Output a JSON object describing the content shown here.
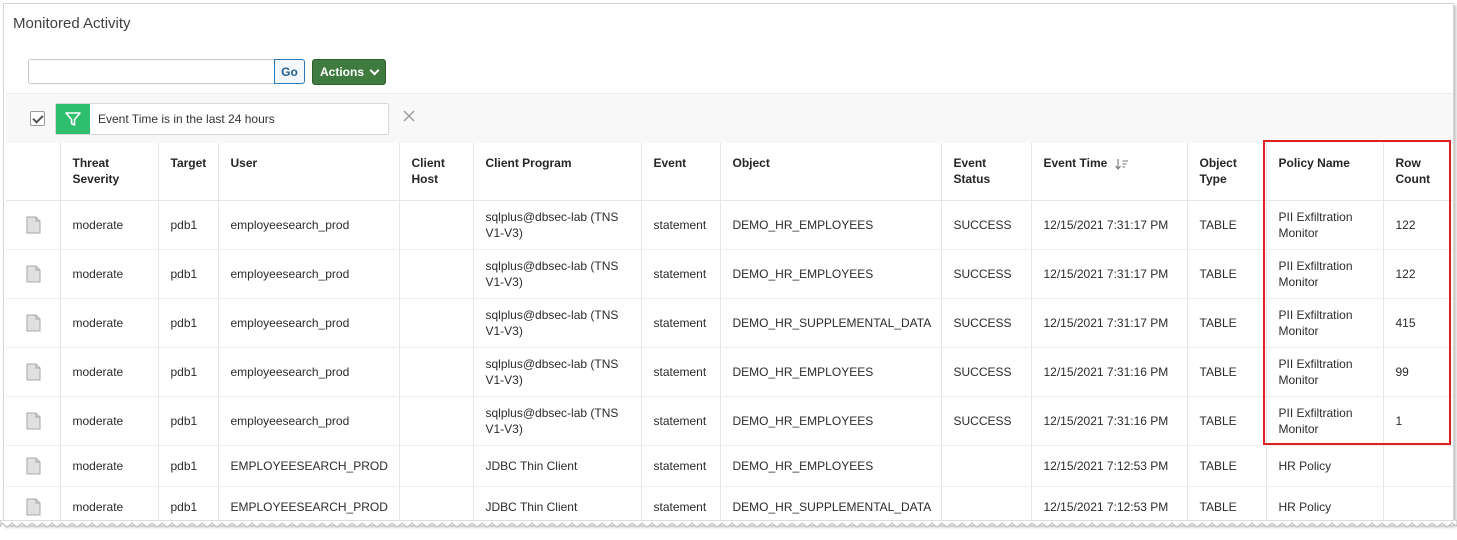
{
  "page": {
    "title": "Monitored Activity"
  },
  "toolbar": {
    "search_value": "",
    "go_label": "Go",
    "actions_label": "Actions"
  },
  "filter": {
    "text": "Event Time is in the last 24 hours",
    "enabled": true
  },
  "table": {
    "columns": [
      {
        "key": "icon",
        "label": ""
      },
      {
        "key": "threat_severity",
        "label": "Threat Severity"
      },
      {
        "key": "target",
        "label": "Target"
      },
      {
        "key": "user",
        "label": "User"
      },
      {
        "key": "client_host",
        "label": "Client Host"
      },
      {
        "key": "client_program",
        "label": "Client Program"
      },
      {
        "key": "event",
        "label": "Event"
      },
      {
        "key": "object",
        "label": "Object"
      },
      {
        "key": "event_status",
        "label": "Event Status"
      },
      {
        "key": "event_time",
        "label": "Event Time",
        "sorted": "descending"
      },
      {
        "key": "object_type",
        "label": "Object Type"
      },
      {
        "key": "policy_name",
        "label": "Policy Name"
      },
      {
        "key": "row_count",
        "label": "Row Count"
      }
    ],
    "rows": [
      {
        "threat_severity": "moderate",
        "target": "pdb1",
        "user": "employeesearch_prod",
        "client_host": "",
        "client_program": "sqlplus@dbsec-lab (TNS V1-V3)",
        "event": "statement",
        "object": "DEMO_HR_EMPLOYEES",
        "event_status": "SUCCESS",
        "event_time": "12/15/2021 7:31:17 PM",
        "object_type": "TABLE",
        "policy_name": "PII Exfiltration Monitor",
        "row_count": "122"
      },
      {
        "threat_severity": "moderate",
        "target": "pdb1",
        "user": "employeesearch_prod",
        "client_host": "",
        "client_program": "sqlplus@dbsec-lab (TNS V1-V3)",
        "event": "statement",
        "object": "DEMO_HR_EMPLOYEES",
        "event_status": "SUCCESS",
        "event_time": "12/15/2021 7:31:17 PM",
        "object_type": "TABLE",
        "policy_name": "PII Exfiltration Monitor",
        "row_count": "122"
      },
      {
        "threat_severity": "moderate",
        "target": "pdb1",
        "user": "employeesearch_prod",
        "client_host": "",
        "client_program": "sqlplus@dbsec-lab (TNS V1-V3)",
        "event": "statement",
        "object": "DEMO_HR_SUPPLEMENTAL_DATA",
        "event_status": "SUCCESS",
        "event_time": "12/15/2021 7:31:17 PM",
        "object_type": "TABLE",
        "policy_name": "PII Exfiltration Monitor",
        "row_count": "415"
      },
      {
        "threat_severity": "moderate",
        "target": "pdb1",
        "user": "employeesearch_prod",
        "client_host": "",
        "client_program": "sqlplus@dbsec-lab (TNS V1-V3)",
        "event": "statement",
        "object": "DEMO_HR_EMPLOYEES",
        "event_status": "SUCCESS",
        "event_time": "12/15/2021 7:31:16 PM",
        "object_type": "TABLE",
        "policy_name": "PII Exfiltration Monitor",
        "row_count": "99"
      },
      {
        "threat_severity": "moderate",
        "target": "pdb1",
        "user": "employeesearch_prod",
        "client_host": "",
        "client_program": "sqlplus@dbsec-lab (TNS V1-V3)",
        "event": "statement",
        "object": "DEMO_HR_EMPLOYEES",
        "event_status": "SUCCESS",
        "event_time": "12/15/2021 7:31:16 PM",
        "object_type": "TABLE",
        "policy_name": "PII Exfiltration Monitor",
        "row_count": "1"
      },
      {
        "threat_severity": "moderate",
        "target": "pdb1",
        "user": "EMPLOYEESEARCH_PROD",
        "client_host": "",
        "client_program": "JDBC Thin Client",
        "event": "statement",
        "object": "DEMO_HR_EMPLOYEES",
        "event_status": "",
        "event_time": "12/15/2021 7:12:53 PM",
        "object_type": "TABLE",
        "policy_name": "HR Policy",
        "row_count": ""
      },
      {
        "threat_severity": "moderate",
        "target": "pdb1",
        "user": "EMPLOYEESEARCH_PROD",
        "client_host": "",
        "client_program": "JDBC Thin Client",
        "event": "statement",
        "object": "DEMO_HR_SUPPLEMENTAL_DATA",
        "event_status": "",
        "event_time": "12/15/2021 7:12:53 PM",
        "object_type": "TABLE",
        "policy_name": "HR Policy",
        "row_count": ""
      }
    ]
  },
  "icons": {
    "filter": "funnel-icon",
    "remove": "close-icon",
    "row": "document-icon",
    "sort": "sort-descending-icon"
  },
  "colors": {
    "actions_bg": "#3f7a3e",
    "filter_icon_bg": "#2ebf6e",
    "highlight": "#e02020"
  }
}
